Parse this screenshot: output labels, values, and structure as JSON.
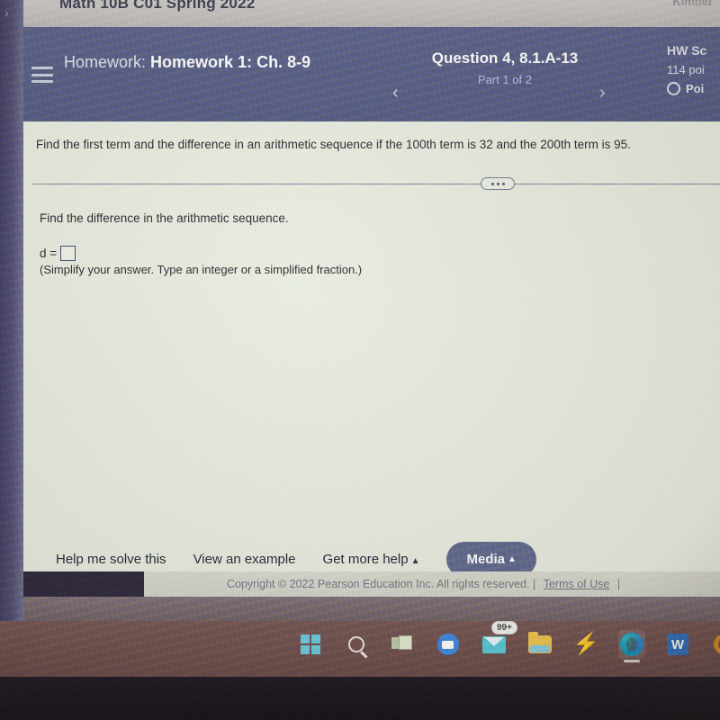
{
  "window": {
    "course_title": "Math 10B C01 Spring 2022",
    "user_name": "Kimber"
  },
  "header": {
    "menu_icon": "hamburger-menu-icon",
    "homework_prefix": "Homework:",
    "homework_name": "Homework 1: Ch. 8-9",
    "prev_arrow": "‹",
    "next_arrow": "›",
    "question_title": "Question 4, 8.1.A-13",
    "question_part": "Part 1 of 2",
    "hw_score_title": "HW Sc",
    "hw_points": "114 poi",
    "progress_label": "Poi",
    "header_bg": "#545980"
  },
  "exercise": {
    "question_stem": "Find the first term and the difference in an arithmetic sequence if the 100th term is 32 and the 200th term is 95.",
    "divider_icon": "ellipsis-expander-icon",
    "sub_question": "Find the difference in the arithmetic sequence.",
    "answer_label": "d =",
    "answer_value": "",
    "hint_text": "(Simplify your answer. Type an integer or a simplified fraction.)"
  },
  "toolbar": {
    "help_me_solve": "Help me solve this",
    "view_example": "View an example",
    "get_more_help": "Get more help",
    "get_more_help_caret": "▲",
    "media_label": "Media",
    "media_caret": "▲",
    "media_bg": "#5d6389"
  },
  "footer": {
    "copyright": "Copyright © 2022 Pearson Education Inc. All rights reserved.",
    "sep1": "|",
    "terms_link": "Terms of Use",
    "sep2": "|"
  },
  "taskbar": {
    "bg": "#6a4b4a",
    "items": [
      {
        "name": "start-icon",
        "label": "Start"
      },
      {
        "name": "search-icon",
        "label": "Search"
      },
      {
        "name": "task-view-icon",
        "label": "Task View"
      },
      {
        "name": "zoom-icon",
        "label": "Zoom"
      },
      {
        "name": "mail-icon",
        "label": "Mail",
        "badge": "99+"
      },
      {
        "name": "file-explorer-icon",
        "label": "File Explorer"
      },
      {
        "name": "lightning-icon",
        "label": "Lightning"
      },
      {
        "name": "edge-icon",
        "label": "Microsoft Edge",
        "active": true
      },
      {
        "name": "word-icon",
        "label": "W"
      },
      {
        "name": "orange-app-icon",
        "label": "App"
      }
    ]
  }
}
